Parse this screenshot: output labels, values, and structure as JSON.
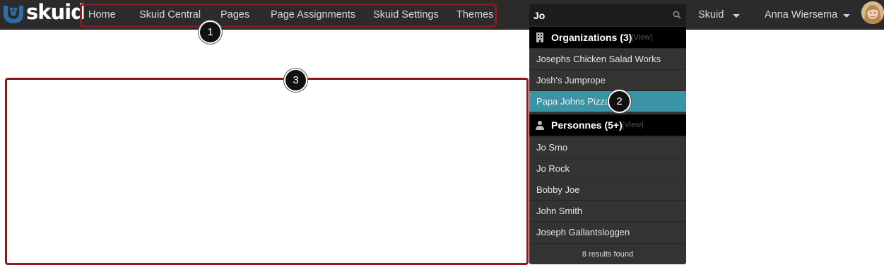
{
  "app": {
    "logo_text": "skuid",
    "brand_color": "#2b6fa8"
  },
  "nav": {
    "items": [
      {
        "label": "Home"
      },
      {
        "label": "Skuid Central"
      },
      {
        "label": "Pages"
      },
      {
        "label": "Page Assignments"
      },
      {
        "label": "Skuid Settings"
      },
      {
        "label": "Themes"
      }
    ],
    "highlight_color": "#8b1a1a"
  },
  "search": {
    "value": "Jo",
    "icon": "search-icon"
  },
  "menus": {
    "org_menu_label": "Skuid",
    "user_menu_label": "Anna Wiersema"
  },
  "results": {
    "groups": [
      {
        "title": "Organizations (3)",
        "view_label": "(View)",
        "icon": "building-icon",
        "items": [
          "Josephs Chicken Salad Works",
          "Josh's Jumprope",
          "Papa Johns Pizza"
        ]
      },
      {
        "title": "Personnes (5+)",
        "view_label": "(View)",
        "icon": "person-icon",
        "items": [
          "Jo Smo",
          "Jo Rock",
          "Bobby Joe",
          "John Smith",
          "Joseph Gallantsloggen"
        ]
      }
    ],
    "selected_item": "Papa Johns Pizza",
    "selected_color": "#3a94a6",
    "footer": "8 results found"
  },
  "callouts": [
    "1",
    "2",
    "3"
  ]
}
